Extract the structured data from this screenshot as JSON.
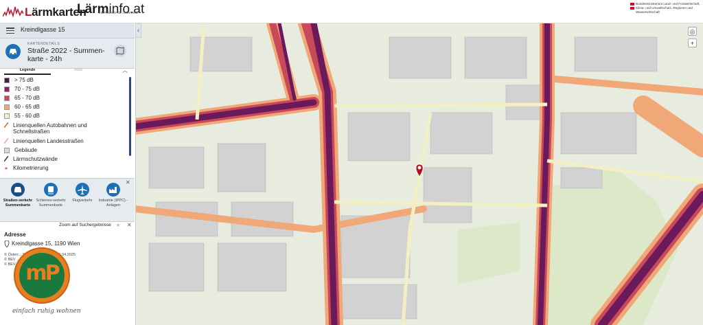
{
  "header": {
    "brand1_prefix": "L",
    "brand1_rest": "ärmkarten",
    "brand2_bold": "Lärm",
    "brand2_light": "info.at",
    "brand2_sub": "Lärmschutz für Österreich",
    "ministry": "Bundesministerium Land- und Forstwirtschaft, Klima- und Umweltschutz, Regionen und Wasserwirtschaft"
  },
  "search": {
    "value": "Kreindlgasse 15"
  },
  "card": {
    "label": "KARTENDETAILS",
    "title": "Straße 2022 - Summen-karte - 24h"
  },
  "legend_tabs": {
    "legend": "Legende",
    "info": "Infos"
  },
  "legend": [
    {
      "label": "> 75 dB",
      "color": "#4a1a4a"
    },
    {
      "label": "70 - 75 dB",
      "color": "#8b2065"
    },
    {
      "label": "65 - 70 dB",
      "color": "#c84a5a"
    },
    {
      "label": "60 - 65 dB",
      "color": "#f0a878"
    },
    {
      "label": "55 - 60 dB",
      "color": "#f3f0c8"
    },
    {
      "label": "Linienquellen Autobahnen und Schnellstraßen",
      "color": "#e05a2a"
    },
    {
      "label": "Linienquellen Landesstraßen",
      "color": "#f0a0a0"
    },
    {
      "label": "Gebäude",
      "color": "#d9d9d9"
    },
    {
      "label": "Lärmschutzwände",
      "color": "#333333"
    },
    {
      "label": "Kilometrierung",
      "color": "#e05a2a"
    }
  ],
  "categories": [
    {
      "label": "Straßen-verkehr Summenkarte",
      "icon": "car-icon",
      "active": true
    },
    {
      "label": "Schienen-verkehr Summenkarte",
      "icon": "train-icon",
      "active": false
    },
    {
      "label": "Flugverkehr",
      "icon": "plane-icon",
      "active": false
    },
    {
      "label": "Industrie (IPPC) - Anlagen",
      "icon": "factory-icon",
      "active": false
    }
  ],
  "zoom_label": "Zoom auf Suchergebnisse",
  "address": {
    "title": "Adresse",
    "value": "Kreindlgasse 15, 1190 Wien"
  },
  "footer": {
    "line1": "© Österr... Stichtagsdaten vom 01.04.2025",
    "line2": "© BEV ...2025",
    "line3": "© BEV ...2025"
  },
  "mp_logo": {
    "text": "mP",
    "slogan": "einfach ruhig wohnen"
  },
  "colors": {
    "accent": "#1f6fb5",
    "noise_high": "#6a1a5a",
    "noise_mid": "#c84a5a",
    "noise_low": "#f0a878"
  }
}
